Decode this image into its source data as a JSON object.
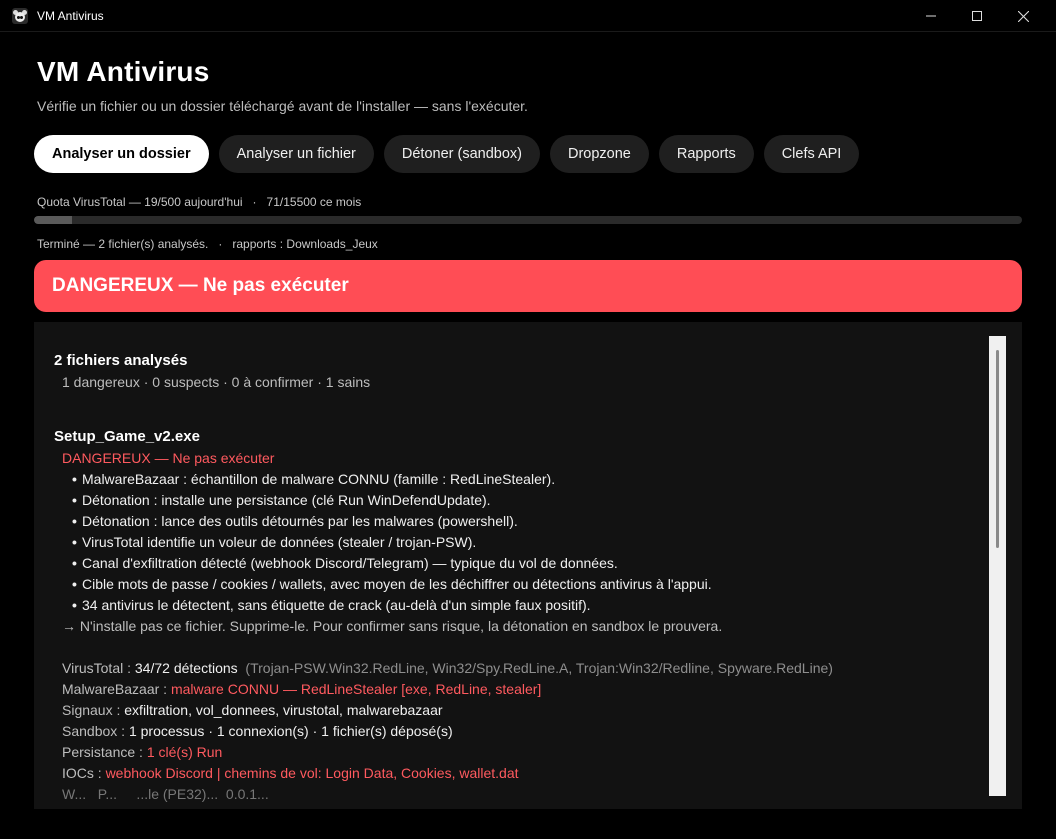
{
  "window": {
    "title": "VM Antivirus",
    "app_icon": "panda-icon"
  },
  "header": {
    "title": "VM Antivirus",
    "subtitle": "Vérifie un fichier ou un dossier téléchargé avant de l'installer — sans l'exécuter."
  },
  "tabs": [
    {
      "label": "Analyser un dossier",
      "active": true
    },
    {
      "label": "Analyser un fichier",
      "active": false
    },
    {
      "label": "Détoner (sandbox)",
      "active": false
    },
    {
      "label": "Dropzone",
      "active": false
    },
    {
      "label": "Rapports",
      "active": false
    },
    {
      "label": "Clefs API",
      "active": false
    }
  ],
  "quota": {
    "text": "Quota VirusTotal — 19/500 aujourd'hui   ·   71/15500 ce mois",
    "day_used": 19,
    "day_limit": 500
  },
  "status": {
    "text": "Terminé — 2 fichier(s) analysés.   ·   rapports : Downloads_Jeux"
  },
  "verdict": {
    "text": "DANGEREUX — Ne pas exécuter",
    "color": "#ff4d55"
  },
  "results": {
    "summary_title": "2 fichiers analysés",
    "summary_counts": "1 dangereux · 0 suspects · 0 à confirmer · 1 sains",
    "file": {
      "name": "Setup_Game_v2.exe",
      "verdict": "DANGEREUX — Ne pas exécuter",
      "reasons": [
        "MalwareBazaar : échantillon de malware CONNU (famille : RedLineStealer).",
        "Détonation : installe une persistance (clé Run WinDefendUpdate).",
        "Détonation : lance des outils détournés par les malwares (powershell).",
        "VirusTotal identifie un voleur de données (stealer / trojan-PSW).",
        "Canal d'exfiltration détecté (webhook Discord/Telegram) — typique du vol de données.",
        "Cible mots de passe / cookies / wallets, avec moyen de les déchiffrer ou détections antivirus à l'appui.",
        "34 antivirus le détectent, sans étiquette de crack (au-delà d'un simple faux positif)."
      ],
      "advice": "→ N'installe pas ce fichier. Supprime-le. Pour confirmer sans risque, la détonation en sandbox le prouvera.",
      "details": {
        "virustotal_key": "VirusTotal :",
        "virustotal_value": "34/72 détections",
        "virustotal_names": "(Trojan-PSW.Win32.RedLine, Win32/Spy.RedLine.A, Trojan:Win32/Redline, Spyware.RedLine)",
        "malwarebazaar_key": "MalwareBazaar :",
        "malwarebazaar_value": "malware CONNU — RedLineStealer [exe, RedLine, stealer]",
        "signals_key": "Signaux :",
        "signals_value": "exfiltration, vol_donnees, virustotal, malwarebazaar",
        "sandbox_key": "Sandbox :",
        "sandbox_value": "1 processus · 1 connexion(s) · 1 fichier(s) déposé(s)",
        "persistence_key": "Persistance :",
        "persistence_value": "1 clé(s) Run",
        "iocs_key": "IOCs :",
        "iocs_value": "webhook Discord | chemins de vol: Login Data, Cookies, wallet.dat",
        "cut_row": "W...   P...     ...le (PE32)...  0.0.1..."
      }
    }
  },
  "colors": {
    "background": "#000000",
    "panel": "#121212",
    "danger": "#ff5a5f",
    "tab_inactive": "#1f1f1f",
    "tab_active": "#ffffff"
  }
}
